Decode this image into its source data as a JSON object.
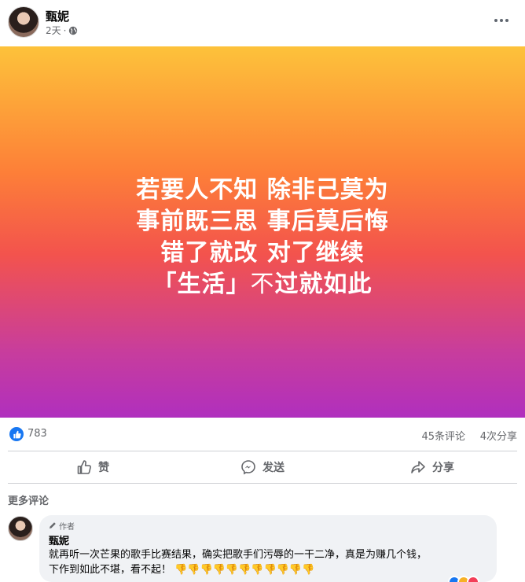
{
  "post": {
    "author": "甄妮",
    "time": "2天",
    "separator": "·",
    "image_lines": [
      "若要人不知 除非己莫为",
      "事前既三思 事后莫后悔",
      "错了就改 对了继续"
    ],
    "last_line": {
      "part1": "「生活」",
      "part2": "不",
      "part3": "过就如此"
    }
  },
  "stats": {
    "likes": "783",
    "comments": "45条评论",
    "shares": "4次分享"
  },
  "actions": {
    "like": "赞",
    "send": "发送",
    "share": "分享"
  },
  "comments_section": {
    "more_label": "更多评论",
    "comment": {
      "badge": "作者",
      "name": "甄妮",
      "text_line1": "就再听一次芒果的歌手比赛结果，确实把歌手们污辱的一干二净，真是为赚几个钱，",
      "text_line2": "下作到如此不堪，看不起！",
      "emoji": "👎👎👎👎👎👎👎👎👎👎👎"
    }
  },
  "colors": {
    "brand_blue": "#1877f2",
    "gradient_top": "#fdc23a",
    "gradient_bottom": "#b02fbe",
    "reaction_red": "#f33e58",
    "reaction_yellow": "#f7b125"
  },
  "icons": [
    "globe-icon",
    "more-icon",
    "like-icon",
    "messenger-icon",
    "share-icon",
    "pencil-icon",
    "thumbs-down-icon"
  ]
}
